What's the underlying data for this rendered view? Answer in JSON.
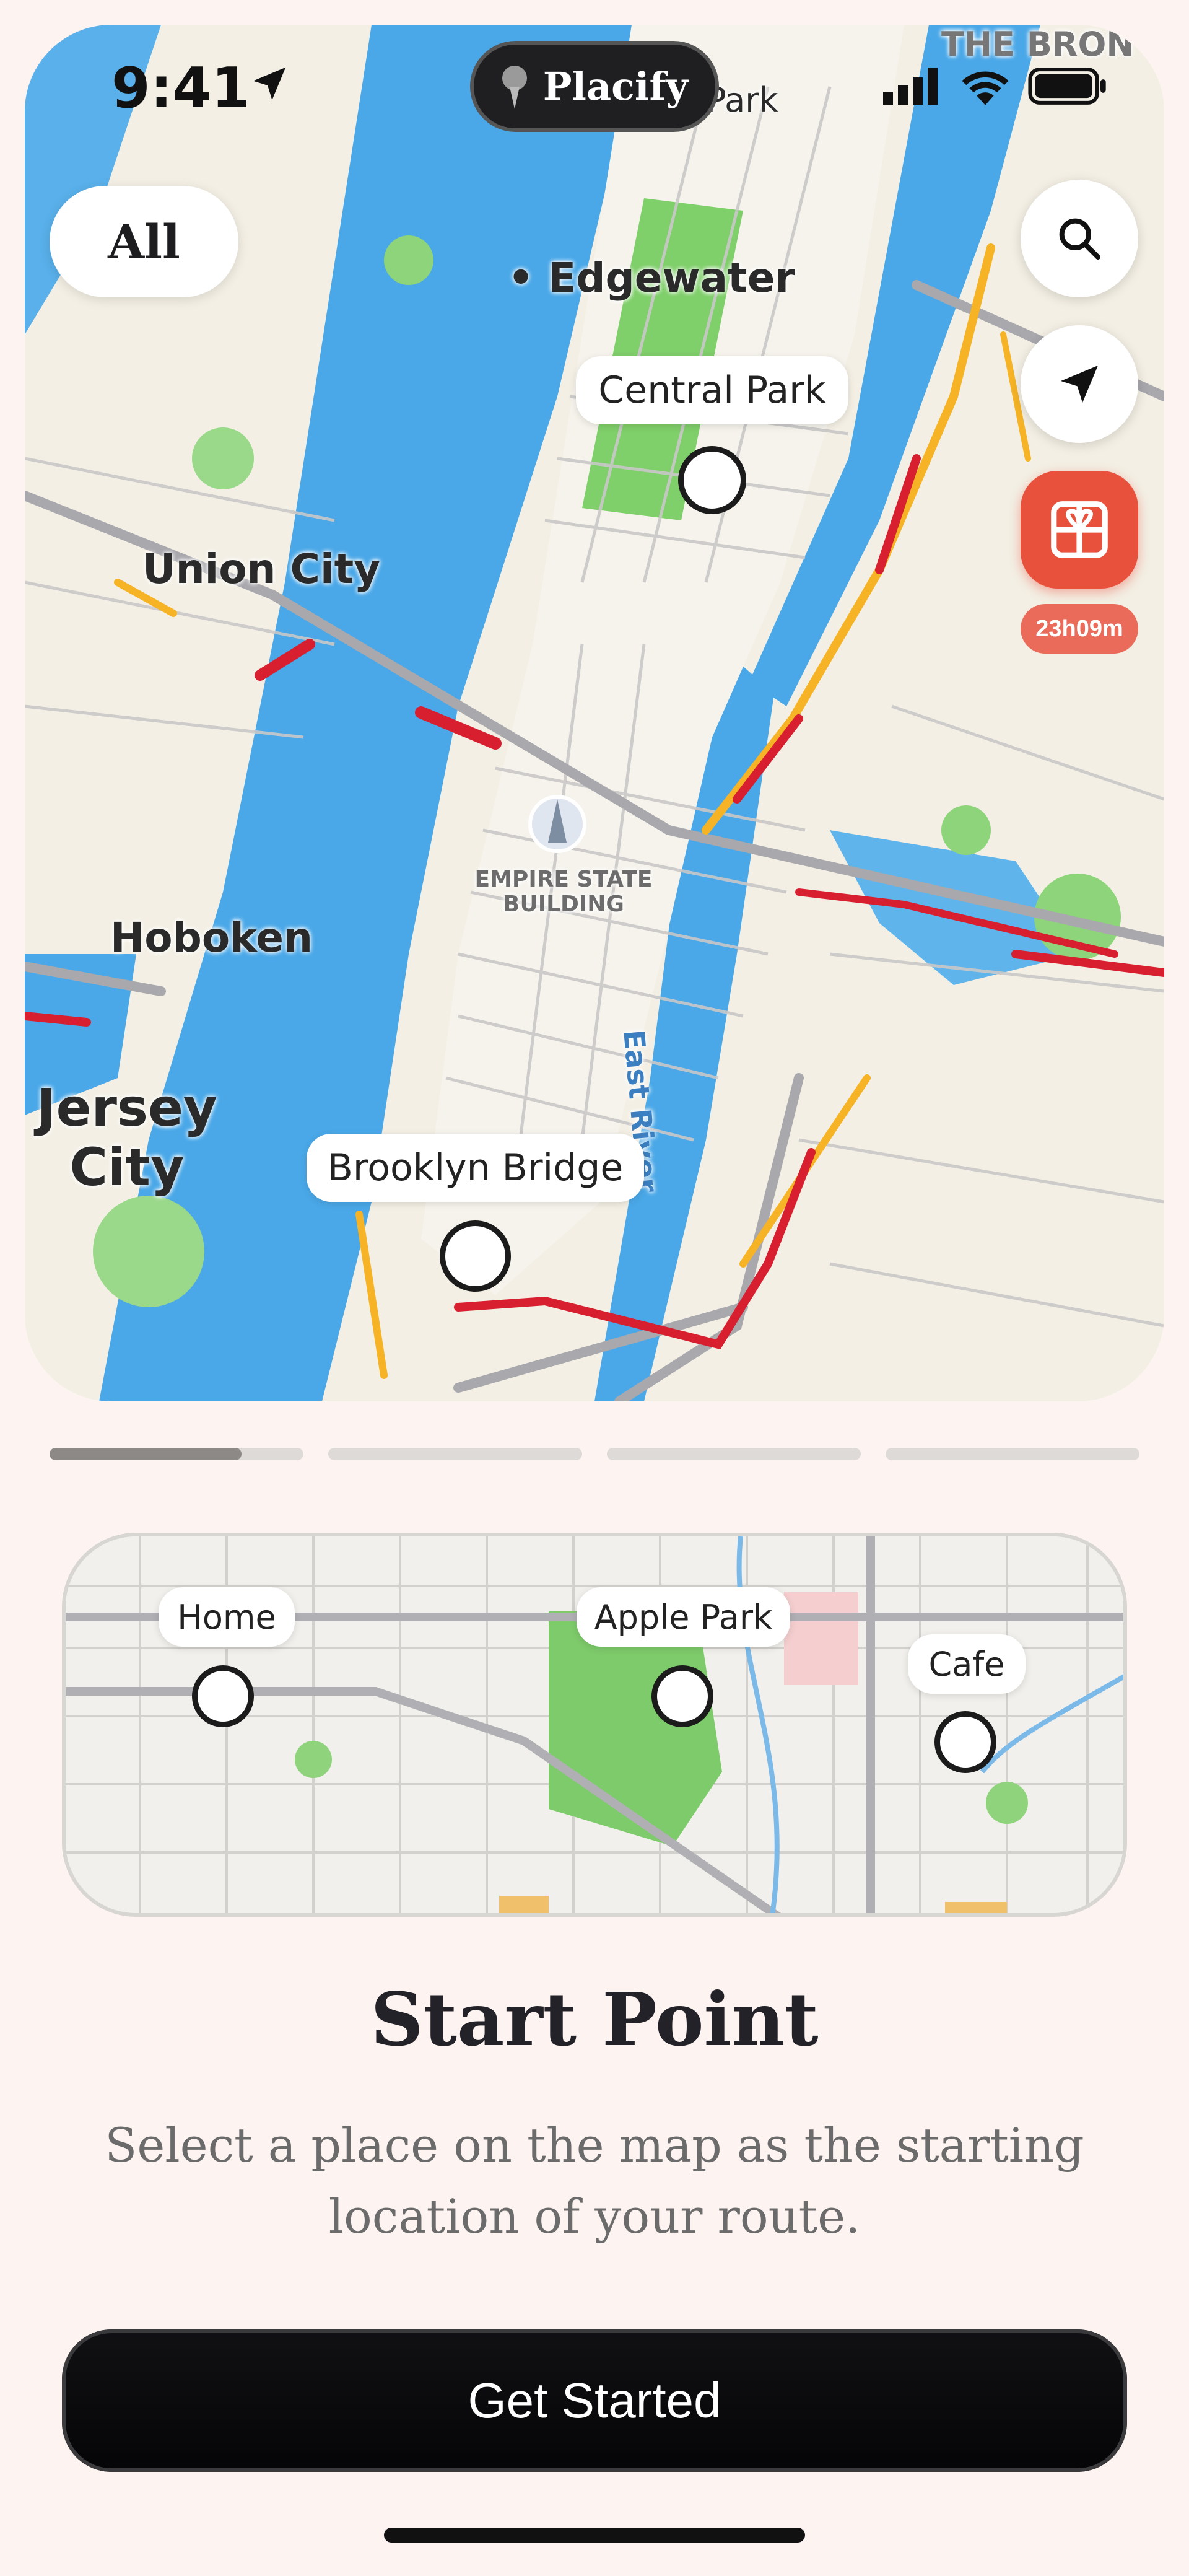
{
  "app": {
    "name": "Placify"
  },
  "status_bar": {
    "time": "9:41"
  },
  "map": {
    "filter_chip": "All",
    "timer": "23h09m",
    "labels": {
      "edgewater": "Edgewater",
      "union_city": "Union City",
      "hoboken": "Hoboken",
      "jersey_city": "Jersey City",
      "east_river": "East River",
      "empire_state": "EMPIRE STATE BUILDING",
      "park_partial": "Park",
      "bronx_partial": "THE BRON"
    },
    "callouts": [
      "Central Park",
      "Brooklyn Bridge"
    ]
  },
  "mini_map": {
    "callouts": [
      "Home",
      "Apple Park",
      "Cafe"
    ]
  },
  "onboarding": {
    "page_count": 4,
    "current_page": 1,
    "title": "Start Point",
    "description": "Select a place on the map as the starting location of your route.",
    "cta": "Get Started"
  },
  "colors": {
    "accent_gift": "#e8523d",
    "cta": "#0a0a0c",
    "background": "#fdf3f1"
  }
}
